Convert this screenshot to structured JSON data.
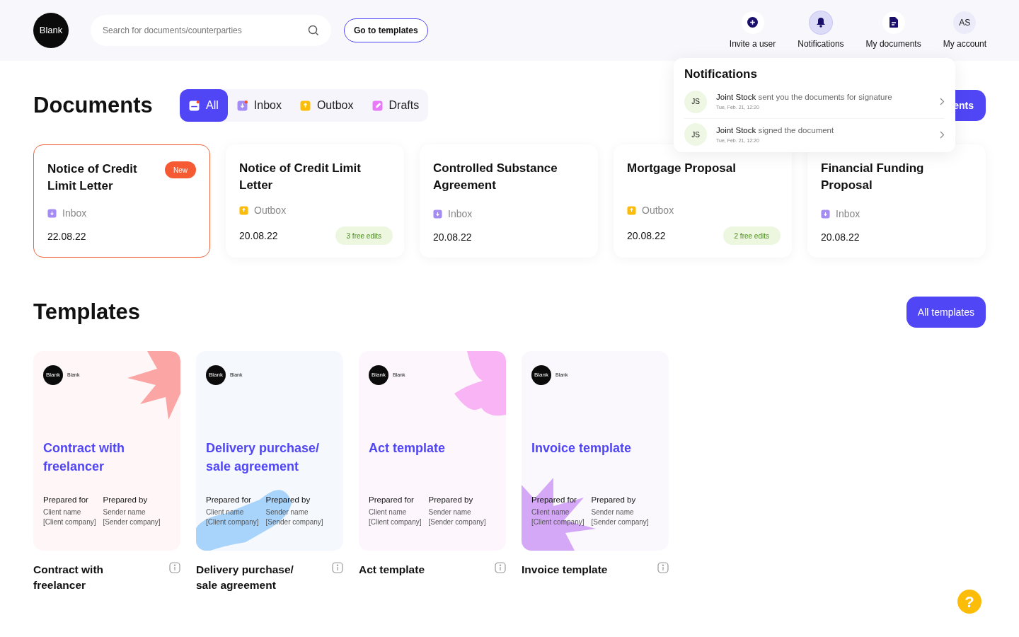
{
  "header": {
    "logo": "Blank",
    "search": {
      "placeholder": "Search for documents/counterparties"
    },
    "templates_button": "Go to templates",
    "nav": [
      {
        "kind": "plus",
        "label": "Invite a user",
        "selected": false
      },
      {
        "kind": "bell",
        "label": "Notifications",
        "selected": true
      },
      {
        "kind": "doc",
        "label": "My documents",
        "selected": false
      },
      {
        "kind": "avatar",
        "initials": "AS",
        "label": "My account",
        "selected": false
      }
    ]
  },
  "documents": {
    "title": "Documents",
    "tabs": [
      {
        "kind": "all",
        "label": "All",
        "selected": true,
        "unread": true
      },
      {
        "kind": "inbox",
        "label": "Inbox",
        "selected": false,
        "unread": true
      },
      {
        "kind": "outbox",
        "label": "Outbox",
        "selected": false,
        "unread": false
      },
      {
        "kind": "drafts",
        "label": "Drafts",
        "selected": false,
        "unread": false
      }
    ],
    "all_button": "ents",
    "cards": [
      {
        "title": "Notice of Credit Limit Letter",
        "badge": "New",
        "kind": "inbox",
        "box": "Inbox",
        "date": "22.08.22",
        "highlighted": true
      },
      {
        "title": "Notice of Credit Limit Letter",
        "kind": "outbox",
        "box": "Outbox",
        "date": "20.08.22",
        "edits": "3 free edits",
        "highlighted": false
      },
      {
        "title": "Controlled Substance Agreement",
        "kind": "inbox",
        "box": "Inbox",
        "date": "20.08.22",
        "highlighted": false
      },
      {
        "title": "Mortgage Proposal",
        "kind": "outbox",
        "box": "Outbox",
        "date": "20.08.22",
        "edits": "2 free edits",
        "highlighted": false
      },
      {
        "title": "Financial Funding Proposal",
        "kind": "inbox",
        "box": "Inbox",
        "date": "20.08.22",
        "highlighted": false
      }
    ]
  },
  "templates": {
    "title": "Templates",
    "all_button": "All templates",
    "items": [
      {
        "logo": "Blank",
        "brand": "Blank",
        "cover_title": "Contract with freelancer",
        "for_label": "Prepared for",
        "client": "Client name",
        "client_company": "[Client company]",
        "by_label": "Prepared by",
        "sender": "Sender name",
        "sender_company": "[Sender company]",
        "name": "Contract with freelancer"
      },
      {
        "logo": "Blank",
        "brand": "Blank",
        "cover_title": "Delivery purchase/ sale agreement",
        "for_label": "Prepared for",
        "client": "Client name",
        "client_company": "[Client company]",
        "by_label": "Prepared by",
        "sender": "Sender name",
        "sender_company": "[Sender company]",
        "name": "Delivery purchase/ sale agreement"
      },
      {
        "logo": "Blank",
        "brand": "Blank",
        "cover_title": "Act template",
        "for_label": "Prepared for",
        "client": "Client name",
        "client_company": "[Client company]",
        "by_label": "Prepared by",
        "sender": "Sender name",
        "sender_company": "[Sender company]",
        "name": "Act template"
      },
      {
        "logo": "Blank",
        "brand": "Blank",
        "cover_title": "Invoice template",
        "for_label": "Prepared for",
        "client": "Client name",
        "client_company": "[Client company]",
        "by_label": "Prepared by",
        "sender": "Sender name",
        "sender_company": "[Sender company]",
        "name": "Invoice template"
      }
    ]
  },
  "notifications": {
    "title": "Notifications",
    "items": [
      {
        "initials": "JS",
        "text": "**Joint Stock** sent you the documents for signature",
        "time": "Tue, Feb. 21, 12:20"
      },
      {
        "initials": "JS",
        "text": "**Joint Stock** signed the document",
        "time": "Tue, Feb. 21, 12:20"
      }
    ]
  },
  "help": "?"
}
